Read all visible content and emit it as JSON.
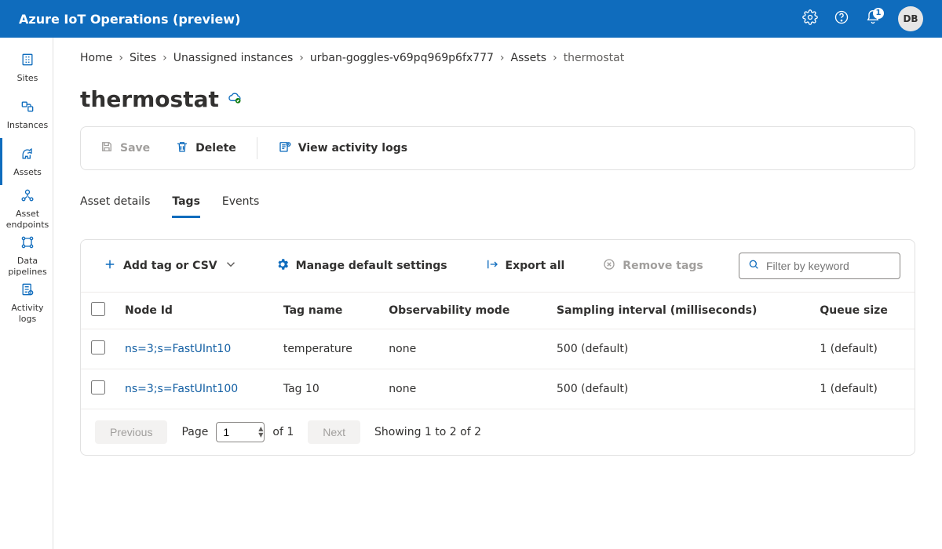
{
  "header": {
    "product_title": "Azure IoT Operations (preview)",
    "notification_count": "1",
    "avatar_initials": "DB"
  },
  "sidebar": {
    "items": [
      {
        "label": "Sites",
        "name": "sidebar-item-sites"
      },
      {
        "label": "Instances",
        "name": "sidebar-item-instances"
      },
      {
        "label": "Assets",
        "name": "sidebar-item-assets"
      },
      {
        "label": "Asset endpoints",
        "name": "sidebar-item-asset-endpoints"
      },
      {
        "label": "Data pipelines",
        "name": "sidebar-item-data-pipelines"
      },
      {
        "label": "Activity logs",
        "name": "sidebar-item-activity-logs"
      }
    ],
    "active_index": 2
  },
  "breadcrumb": {
    "items": [
      "Home",
      "Sites",
      "Unassigned instances",
      "urban-goggles-v69pq969p6fx777",
      "Assets",
      "thermostat"
    ]
  },
  "page": {
    "title": "thermostat"
  },
  "toolbar": {
    "save_label": "Save",
    "delete_label": "Delete",
    "view_logs_label": "View activity logs"
  },
  "tabs": {
    "items": [
      "Asset details",
      "Tags",
      "Events"
    ],
    "active_index": 1
  },
  "tag_toolbar": {
    "add_label": "Add tag or CSV",
    "manage_label": "Manage default settings",
    "export_label": "Export all",
    "remove_label": "Remove tags",
    "filter_placeholder": "Filter by keyword"
  },
  "table": {
    "columns": [
      "Node Id",
      "Tag name",
      "Observability mode",
      "Sampling interval (milliseconds)",
      "Queue size"
    ],
    "rows": [
      {
        "node_id": "ns=3;s=FastUInt10",
        "tag_name": "temperature",
        "obs": "none",
        "sampling": "500 (default)",
        "queue": "1 (default)"
      },
      {
        "node_id": "ns=3;s=FastUInt100",
        "tag_name": "Tag 10",
        "obs": "none",
        "sampling": "500 (default)",
        "queue": "1 (default)"
      }
    ]
  },
  "pager": {
    "previous": "Previous",
    "next": "Next",
    "page_label": "Page",
    "page_value": "1",
    "of_text": "of 1",
    "showing_text": "Showing 1 to 2 of 2"
  }
}
